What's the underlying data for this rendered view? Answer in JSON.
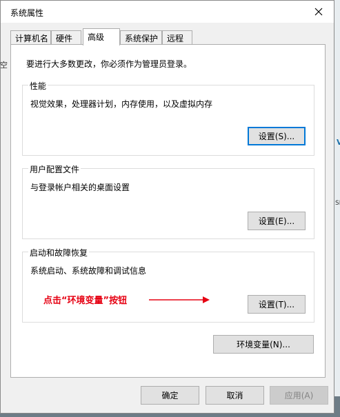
{
  "window": {
    "title": "系统属性"
  },
  "tabs": [
    {
      "label": "计算机名"
    },
    {
      "label": "硬件"
    },
    {
      "label": "高级",
      "active": true
    },
    {
      "label": "系统保护"
    },
    {
      "label": "远程"
    }
  ],
  "notice": "要进行大多数更改，你必须作为管理员登录。",
  "groups": {
    "performance": {
      "title": "性能",
      "description": "视觉效果，处理器计划，内存使用，以及虚拟内存",
      "button": "设置(S)..."
    },
    "user_profiles": {
      "title": "用户配置文件",
      "description": "与登录帐户相关的桌面设置",
      "button": "设置(E)..."
    },
    "startup_recovery": {
      "title": "启动和故障恢复",
      "description": "系统启动、系统故障和调试信息",
      "button": "设置(T)..."
    }
  },
  "annotation": {
    "text": "点击“环境变量”按钮",
    "color": "#e60012"
  },
  "env_button": "环境变量(N)...",
  "footer": {
    "ok": "确定",
    "cancel": "取消",
    "apply": "应用(A)"
  },
  "background_fragments": {
    "left": "空",
    "right_v": "V",
    "right_sh": "SH"
  },
  "colors": {
    "accent": "#0078d7",
    "annotation": "#e60012"
  }
}
